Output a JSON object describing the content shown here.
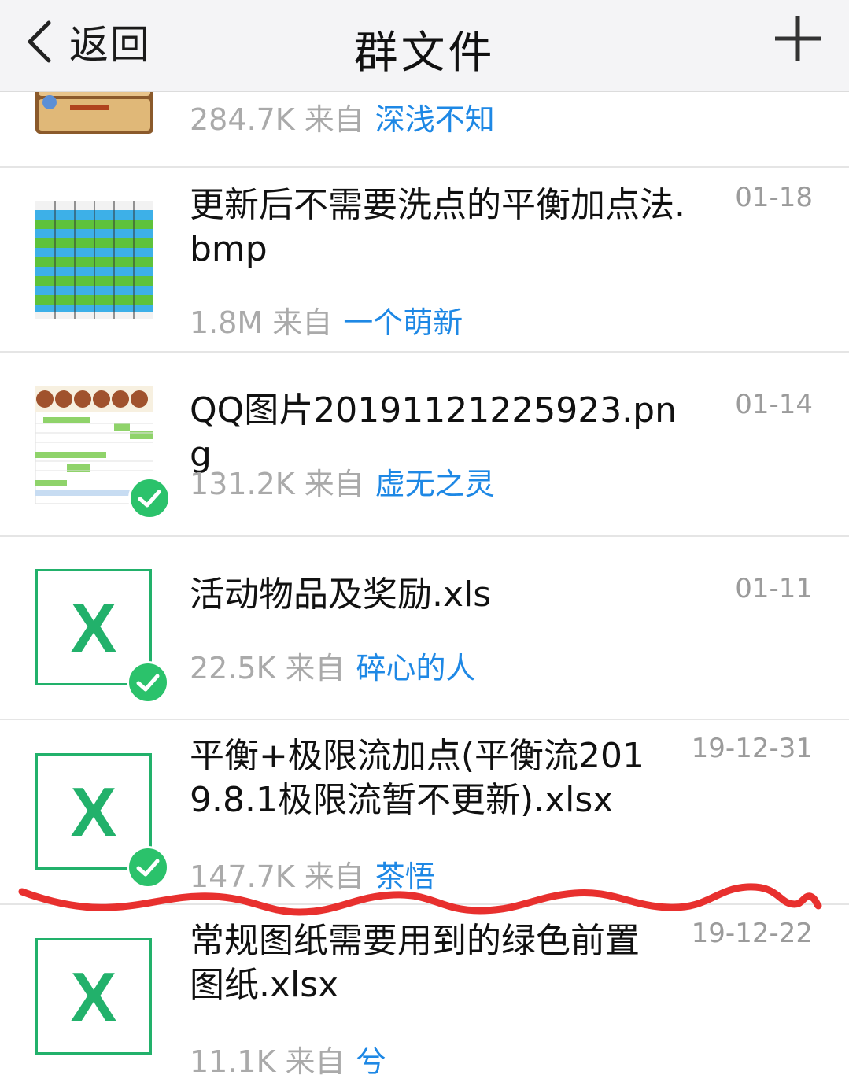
{
  "header": {
    "back_label": "返回",
    "title": "群文件"
  },
  "files": [
    {
      "name": "",
      "date": "",
      "size": "284.7K",
      "from_label": "来自",
      "uploader": "深浅不知",
      "thumb": "game-ui-image",
      "downloaded": false
    },
    {
      "name": "更新后不需要洗点的平衡加点法.bmp",
      "date": "01-18",
      "size": "1.8M",
      "from_label": "来自",
      "uploader": "一个萌新",
      "thumb": "spreadsheet-image",
      "downloaded": false
    },
    {
      "name": "QQ图片20191121225923.png",
      "date": "01-14",
      "size": "131.2K",
      "from_label": "来自",
      "uploader": "虚无之灵",
      "thumb": "spreadsheet-image-2",
      "downloaded": true
    },
    {
      "name": "活动物品及奖励.xls",
      "date": "01-11",
      "size": "22.5K",
      "from_label": "来自",
      "uploader": "碎心的人",
      "thumb": "excel-icon",
      "icon_letter": "X",
      "downloaded": true
    },
    {
      "name": "平衡+极限流加点(平衡流2019.8.1极限流暂不更新).xlsx",
      "date": "19-12-31",
      "size": "147.7K",
      "from_label": "来自",
      "uploader": "茶悟",
      "thumb": "excel-icon",
      "icon_letter": "X",
      "downloaded": true
    },
    {
      "name": "常规图纸需要用到的绿色前置图纸.xlsx",
      "date": "19-12-22",
      "size": "11.1K",
      "from_label": "来自",
      "uploader": "兮",
      "thumb": "excel-icon",
      "icon_letter": "X",
      "downloaded": false
    }
  ],
  "colors": {
    "excel_green": "#22b16b",
    "check_green": "#2bc26b",
    "uploader_blue": "#1e88e5",
    "scribble_red": "#e8302e"
  }
}
